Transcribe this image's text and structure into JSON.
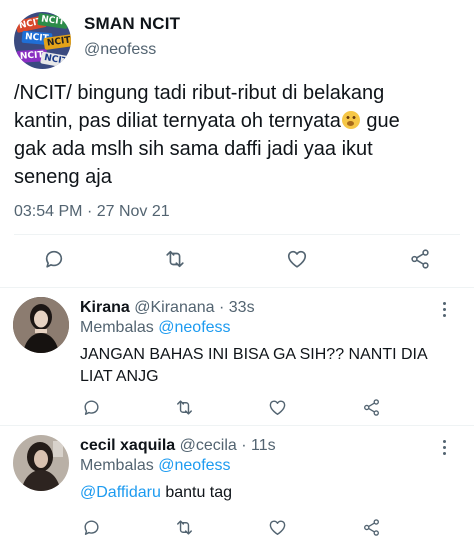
{
  "tweet": {
    "author_name": "SMAN NCIT",
    "author_handle": "@neofess",
    "avatar_stickers": [
      "NCIT",
      "NCIT",
      "NCIT",
      "NCIT",
      "NCIT",
      "NCIT"
    ],
    "text_lines": [
      "/NCIT/ bingung tadi ribut-ribut di belakang",
      "kantin, pas diliat ternyata oh ternyata",
      "gak ada mslh sih sama daffi jadi yaa ikut",
      "seneng aja"
    ],
    "text_line2_after_emoji": " gue",
    "emoji": "face-with-hand-over-mouth",
    "time": "03:54 PM",
    "dot": "·",
    "date": "27 Nov 21"
  },
  "replies": [
    {
      "name": "Kirana",
      "handle": "@Kiranana",
      "dot": "·",
      "age": "33s",
      "replying_label": "Membalas",
      "replying_to": "@neofess",
      "text": "JANGAN BAHAS INI BISA GA SIH?? NANTI DIA LIAT ANJG",
      "text_mention": "",
      "text_rest": ""
    },
    {
      "name": "cecil xaquila",
      "handle": "@cecila",
      "dot": "·",
      "age": "11s",
      "replying_label": "Membalas",
      "replying_to": "@neofess",
      "text": "",
      "text_mention": "@Daffidaru",
      "text_rest": " bantu tag"
    }
  ],
  "colors": {
    "text": "#0f1419",
    "secondary": "#536471",
    "accent": "#1d9bf0",
    "divider": "#eff3f4"
  },
  "icons": [
    "reply-icon",
    "retweet-icon",
    "like-icon",
    "share-icon",
    "more-icon"
  ]
}
